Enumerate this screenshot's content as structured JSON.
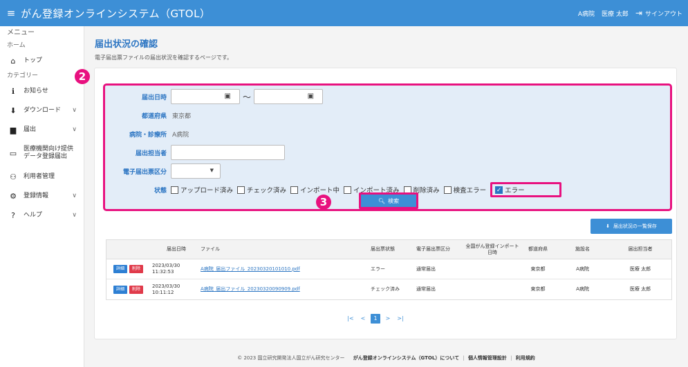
{
  "header": {
    "title": "がん登録オンラインシステム（GTOL）",
    "user_hospital": "A病院",
    "user_name": "医療 太郎",
    "signout": "サインアウト"
  },
  "sidebar": {
    "menu_label": "メニュー",
    "home_section": "ホーム",
    "category_section": "カテゴリー",
    "items": [
      {
        "label": "トップ",
        "icon": "home-icon",
        "glyph": "⌂"
      },
      {
        "label": "お知らせ",
        "icon": "info-icon",
        "glyph": "ℹ"
      },
      {
        "label": "ダウンロード",
        "icon": "download-icon",
        "glyph": "⬇"
      },
      {
        "label": "届出",
        "icon": "file-icon",
        "glyph": "▆"
      },
      {
        "label": "医療機関向け提供データ登録届出",
        "icon": "monitor-icon",
        "glyph": "▭"
      },
      {
        "label": "利用者管理",
        "icon": "users-icon",
        "glyph": "⚇"
      },
      {
        "label": "登録情報",
        "icon": "user-settings-icon",
        "glyph": "⚙"
      },
      {
        "label": "ヘルプ",
        "icon": "help-icon",
        "glyph": "?"
      }
    ]
  },
  "page": {
    "title": "届出状況の確認",
    "description": "電子届出票ファイルの届出状況を確認するページです。"
  },
  "badges": {
    "b2": "2",
    "b3": "3"
  },
  "search": {
    "date_label": "届出日時",
    "date_from": "",
    "date_to": "",
    "tilde": "～",
    "pref_label": "都道府県",
    "pref_value": "東京都",
    "hospital_label": "病院・診療所",
    "hospital_value": "A病院",
    "reporter_label": "届出担当者",
    "reporter_value": "",
    "kind_label": "電子届出票区分",
    "kind_value": "",
    "status_label": "状態",
    "statuses": [
      {
        "label": "アップロード済み",
        "checked": false
      },
      {
        "label": "チェック済み",
        "checked": false
      },
      {
        "label": "インポート中",
        "checked": false
      },
      {
        "label": "インポート済み",
        "checked": false
      },
      {
        "label": "削除済み",
        "checked": false
      },
      {
        "label": "検査エラー",
        "checked": false
      },
      {
        "label": "エラー",
        "checked": true
      }
    ],
    "search_button": "検索"
  },
  "save_button": "届出状況の一覧保存",
  "table": {
    "headers": {
      "date": "届出日時",
      "file": "ファイル",
      "status": "届出票状態",
      "kind": "電子届出票区分",
      "imported": "全国がん登録インポート日時",
      "pref": "都道府県",
      "facility": "施設名",
      "reporter": "届出担当者"
    },
    "detail_label": "詳細",
    "delete_label": "削除",
    "rows": [
      {
        "date": "2023/03/30",
        "time": "11:32:53",
        "file": "A病院_届出ファイル_20230320101010.pdf",
        "status": "エラー",
        "kind": "通常届出",
        "imported": "",
        "pref": "東京都",
        "facility": "A病院",
        "reporter": "医療 太郎"
      },
      {
        "date": "2023/03/30",
        "time": "10:11:12",
        "file": "A病院_届出ファイル_20230320090909.pdf",
        "status": "チェック済み",
        "kind": "通常届出",
        "imported": "",
        "pref": "東京都",
        "facility": "A病院",
        "reporter": "医療 太郎"
      }
    ]
  },
  "pager": {
    "first": "|<",
    "prev": "<",
    "current": "1",
    "next": ">",
    "last": ">|"
  },
  "footer": {
    "copyright": "© 2023 国立研究開発法人国立がん研究センター",
    "link_about": "がん登録オンラインシステム（GTOL）について",
    "link_privacy": "個人情報管理設計",
    "link_terms": "利用規約",
    "sep": "|"
  },
  "colors": {
    "accent": "#3d8fd6",
    "highlight": "#e8117f",
    "link": "#2a74c2"
  }
}
